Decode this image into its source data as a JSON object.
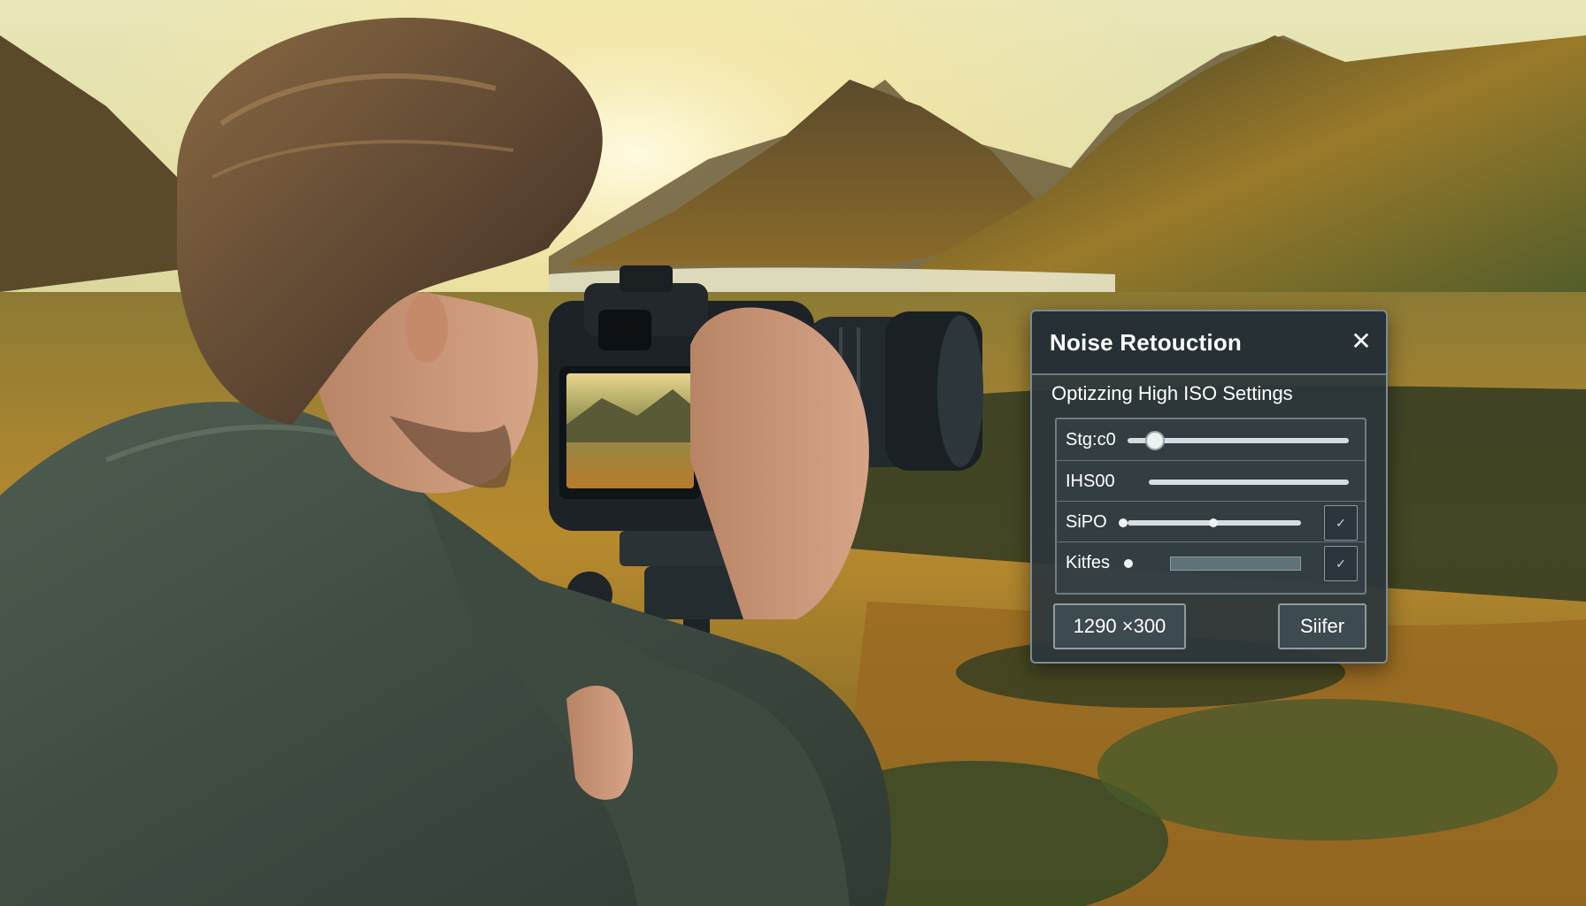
{
  "dialog": {
    "title": "Noise Retouction",
    "subtitle": "Optizzing High ISO Settings",
    "close_symbol": "✕",
    "rows": [
      {
        "label": "Stg:c0"
      },
      {
        "label": "IHS00"
      },
      {
        "label": "SiPO",
        "check": "✓"
      },
      {
        "label": "Kitfes",
        "check": "✓"
      }
    ],
    "resolution_button": "1290 ×300",
    "action_button": "Siifer"
  },
  "colors": {
    "panel_bg": "#2c363c",
    "panel_border": "#7d8b92",
    "text": "#ffffff"
  }
}
